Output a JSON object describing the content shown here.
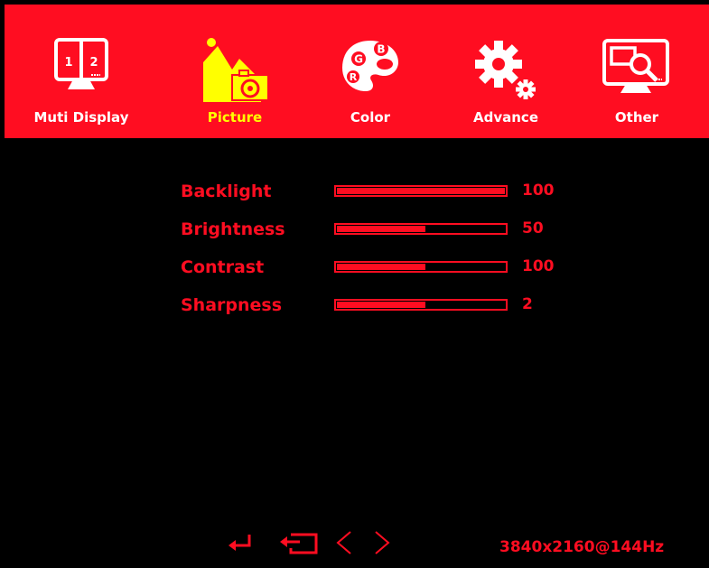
{
  "tabs": [
    {
      "label": "Muti Display",
      "icon": "multi-display-icon",
      "icon_text": [
        "1",
        "2"
      ],
      "active": false
    },
    {
      "label": "Picture",
      "icon": "picture-icon",
      "active": true
    },
    {
      "label": "Color",
      "icon": "color-palette-icon",
      "icon_text": [
        "B",
        "G",
        "R"
      ],
      "active": false
    },
    {
      "label": "Advance",
      "icon": "gear-icon",
      "active": false
    },
    {
      "label": "Other",
      "icon": "monitor-search-icon",
      "active": false
    }
  ],
  "settings": [
    {
      "label": "Backlight",
      "value": "100",
      "level": 1.0
    },
    {
      "label": "Brightness",
      "value": "50",
      "level": 0.53
    },
    {
      "label": "Contrast",
      "value": "100",
      "level": 0.53
    },
    {
      "label": "Sharpness",
      "value": "2",
      "level": 0.53
    }
  ],
  "nav": [
    "enter-icon",
    "exit-icon",
    "left-arrow-icon",
    "right-arrow-icon"
  ],
  "resolution": "3840x2160@144Hz",
  "colors": {
    "accent": "#ff0d21",
    "active_tab": "#ffff00",
    "background": "#000000"
  }
}
